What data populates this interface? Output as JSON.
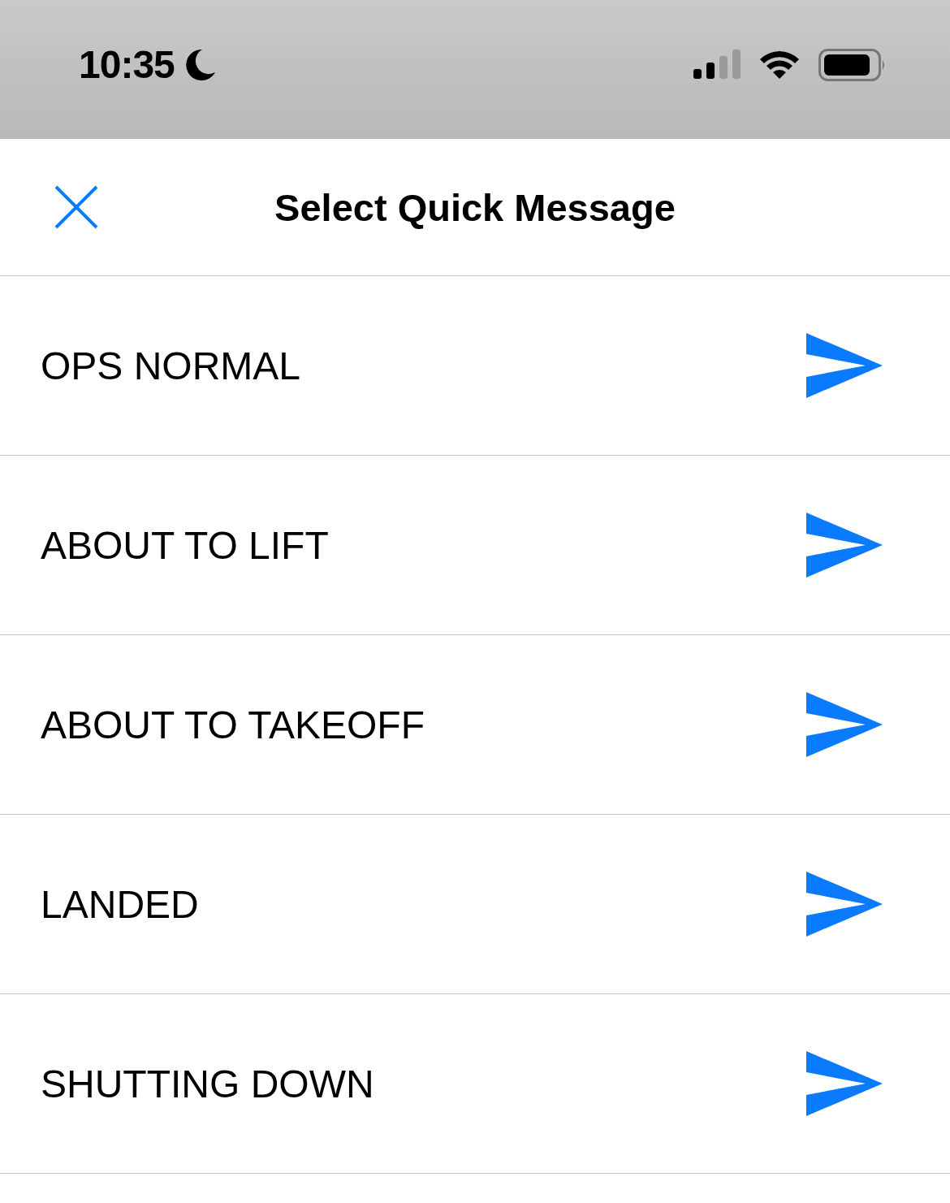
{
  "status_bar": {
    "time": "10:35"
  },
  "sheet": {
    "title": "Select Quick Message"
  },
  "messages": [
    {
      "label": "OPS NORMAL"
    },
    {
      "label": "ABOUT TO LIFT"
    },
    {
      "label": "ABOUT TO TAKEOFF"
    },
    {
      "label": "LANDED"
    },
    {
      "label": "SHUTTING DOWN"
    }
  ]
}
